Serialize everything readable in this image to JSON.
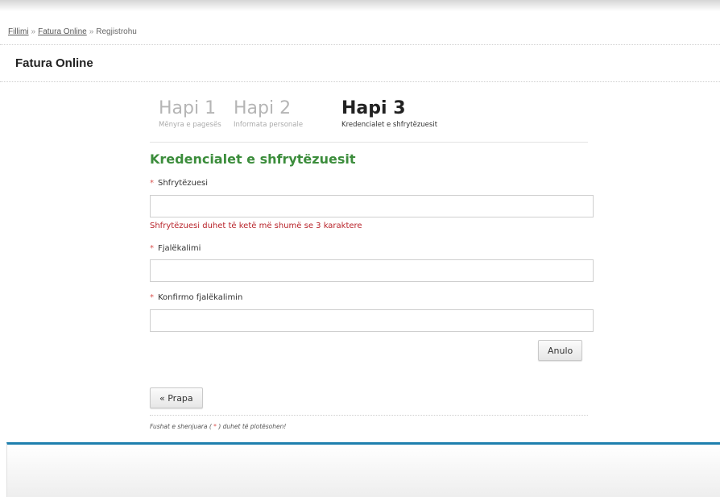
{
  "breadcrumb": {
    "items": [
      "Fillimi",
      "Fatura Online",
      "Regjistrohu"
    ],
    "separator": "»"
  },
  "page_title": "Fatura Online",
  "steps": [
    {
      "title": "Hapi 1",
      "subtitle": "Mënyra e pagesës"
    },
    {
      "title": "Hapi 2",
      "subtitle": "Informata personale"
    },
    {
      "title": "Hapi 3",
      "subtitle": "Kredencialet e shfrytëzuesit"
    }
  ],
  "active_step": 3,
  "form": {
    "section_title": "Kredencialet e shfrytëzuesit",
    "required_marker": "*",
    "username_label": "Shfrytëzuesi",
    "username_value": "",
    "username_error": "Shfrytëzuesi duhet të ketë më shumë se 3 karaktere",
    "password_label": "Fjalëkalimi",
    "password_value": "",
    "confirm_label": "Konfirmo fjalëkalimin",
    "confirm_value": ""
  },
  "buttons": {
    "cancel": "Anulo",
    "back": "« Prapa"
  },
  "footnote": {
    "before": "Fushat e shenjuara (",
    "marker": " * ",
    "after": ") duhet të plotësohen!"
  },
  "colors": {
    "section_title": "#3c8d3c",
    "error": "#b8232a",
    "required": "#d9534f",
    "footer_accent": "#1f7fae"
  }
}
